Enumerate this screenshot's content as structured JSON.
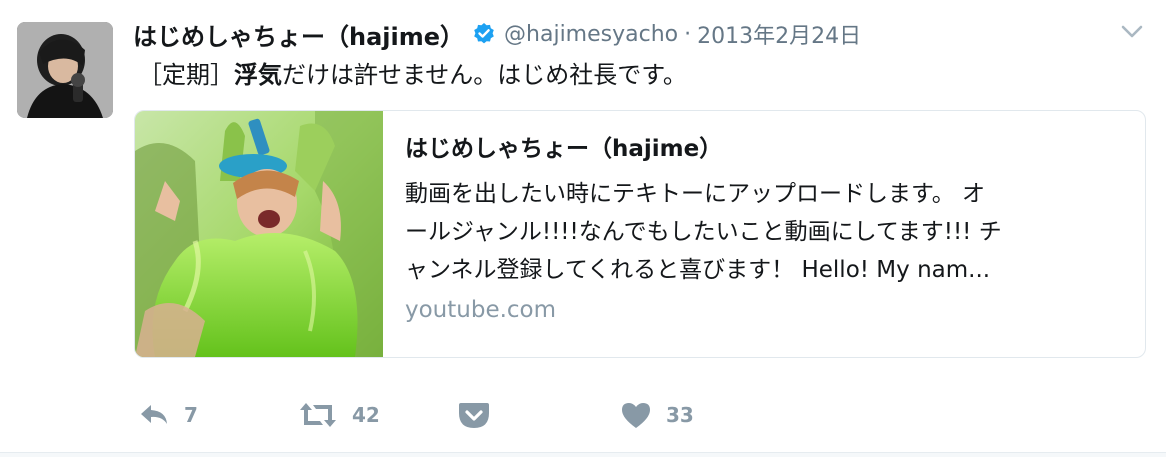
{
  "tweet": {
    "display_name": "はじめしゃちょー（hajime）",
    "handle": "@hajimesyacho",
    "separator": "·",
    "timestamp": "2013年2月24日",
    "text_prefix": "［定期］",
    "text_bold": "浮気",
    "text_suffix": "だけは許せません。はじめ社長です。"
  },
  "card": {
    "title": "はじめしゃちょー（hajime）",
    "description_lines": [
      "動画を出したい時にテキトーにアップロードします。 オ",
      "ールジャンル!!!!なんでもしたいこと動画にしてます!!! チ",
      "ャンネル登録してくれると喜びます！ Hello! My nam..."
    ],
    "domain": "youtube.com"
  },
  "actions": {
    "reply_count": "7",
    "retweet_count": "42",
    "like_count": "33"
  },
  "colors": {
    "verified_blue": "#1da1f2",
    "muted_gray": "#8899a6",
    "slime_green": "#8fd14f"
  }
}
